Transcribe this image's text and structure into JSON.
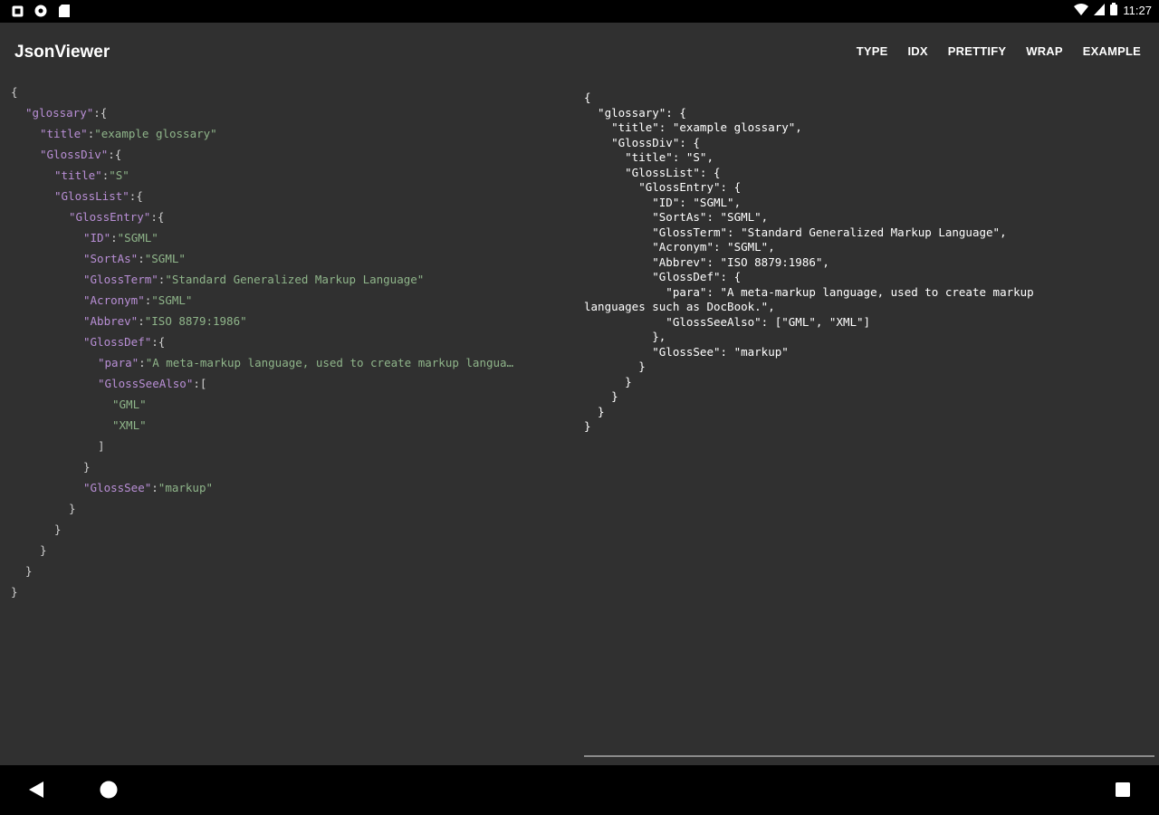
{
  "status_bar": {
    "time": "11:27"
  },
  "app": {
    "title": "JsonViewer"
  },
  "toolbar": {
    "actions": [
      "TYPE",
      "IDX",
      "PRETTIFY",
      "WRAP",
      "EXAMPLE"
    ]
  },
  "tree": {
    "lines": [
      {
        "brace": "{"
      },
      {
        "key": "\"glossary\"",
        "colon": ":",
        "brace": "{"
      },
      {
        "key": "\"title\"",
        "colon": ":",
        "value": "\"example glossary\""
      },
      {
        "key": "\"GlossDiv\"",
        "colon": ":",
        "brace": "{"
      },
      {
        "key": "\"title\"",
        "colon": ":",
        "value": "\"S\""
      },
      {
        "key": "\"GlossList\"",
        "colon": ":",
        "brace": "{"
      },
      {
        "key": "\"GlossEntry\"",
        "colon": ":",
        "brace": "{"
      },
      {
        "key": "\"ID\"",
        "colon": ":",
        "value": "\"SGML\""
      },
      {
        "key": "\"SortAs\"",
        "colon": ":",
        "value": "\"SGML\""
      },
      {
        "key": "\"GlossTerm\"",
        "colon": ":",
        "value": "\"Standard Generalized Markup Language\""
      },
      {
        "key": "\"Acronym\"",
        "colon": ":",
        "value": "\"SGML\""
      },
      {
        "key": "\"Abbrev\"",
        "colon": ":",
        "value": "\"ISO 8879:1986\""
      },
      {
        "key": "\"GlossDef\"",
        "colon": ":",
        "brace": "{"
      },
      {
        "key": "\"para\"",
        "colon": ":",
        "value": "\"A meta-markup language, used to create markup langua…"
      },
      {
        "key": "\"GlossSeeAlso\"",
        "colon": ":",
        "brace": "["
      },
      {
        "value": "\"GML\""
      },
      {
        "value": "\"XML\""
      },
      {
        "brace": "]"
      },
      {
        "brace": "}"
      },
      {
        "key": "\"GlossSee\"",
        "colon": ":",
        "value": "\"markup\""
      },
      {
        "brace": "}"
      },
      {
        "brace": "}"
      },
      {
        "brace": "}"
      },
      {
        "brace": "}"
      },
      {
        "brace": "}"
      }
    ]
  },
  "raw": {
    "lines": [
      "{",
      "  \"glossary\": {",
      "    \"title\": \"example glossary\",",
      "    \"GlossDiv\": {",
      "      \"title\": \"S\",",
      "      \"GlossList\": {",
      "        \"GlossEntry\": {",
      "          \"ID\": \"SGML\",",
      "          \"SortAs\": \"SGML\",",
      "          \"GlossTerm\": \"Standard Generalized Markup Language\",",
      "          \"Acronym\": \"SGML\",",
      "          \"Abbrev\": \"ISO 8879:1986\",",
      "          \"GlossDef\": {",
      "            \"para\": \"A meta-markup language, used to create markup",
      "languages such as DocBook.\",",
      "            \"GlossSeeAlso\": [\"GML\", \"XML\"]",
      "          },",
      "          \"GlossSee\": \"markup\"",
      "        }",
      "      }",
      "    }",
      "  }",
      "}"
    ]
  }
}
